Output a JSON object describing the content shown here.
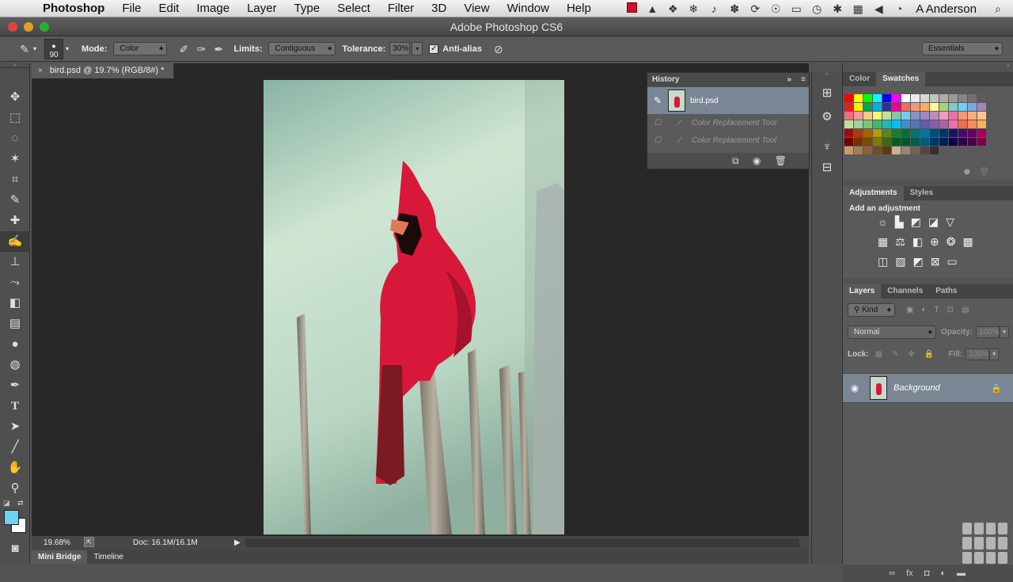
{
  "menubar": {
    "app_name": "Photoshop",
    "items": [
      "File",
      "Edit",
      "Image",
      "Layer",
      "Type",
      "Select",
      "Filter",
      "3D",
      "View",
      "Window",
      "Help"
    ],
    "user": "A Anderson"
  },
  "window": {
    "title": "Adobe Photoshop CS6"
  },
  "options": {
    "brush_size": "90",
    "mode_label": "Mode:",
    "mode_value": "Color",
    "limits_label": "Limits:",
    "limits_value": "Contiguous",
    "tolerance_label": "Tolerance:",
    "tolerance_value": "30%",
    "antialias_label": "Anti-alias",
    "workspace": "Essentials"
  },
  "document": {
    "tab_label": "bird.psd @ 19.7% (RGB/8#) *",
    "zoom": "19.68%",
    "doc_size": "Doc: 16.1M/16.1M"
  },
  "bottom_tabs": [
    "Mini Bridge",
    "Timeline"
  ],
  "history": {
    "title": "History",
    "snapshot": "bird.psd",
    "steps": [
      "Color Replacement Tool",
      "Color Replacement Tool"
    ]
  },
  "color_panel": {
    "tabs": [
      "Color",
      "Swatches"
    ]
  },
  "adjustments": {
    "tabs": [
      "Adjustments",
      "Styles"
    ],
    "heading": "Add an adjustment"
  },
  "layers": {
    "tabs": [
      "Layers",
      "Channels",
      "Paths"
    ],
    "kind": "Kind",
    "blend": "Normal",
    "opacity_label": "Opacity:",
    "opacity_value": "100%",
    "lock_label": "Lock:",
    "fill_label": "Fill:",
    "fill_value": "100%",
    "layer_name": "Background"
  },
  "colors": {
    "foreground": "#6fd3f5",
    "background": "#ffffff",
    "cardinal_red": "#d8183a",
    "panel_bg": "#535353"
  }
}
